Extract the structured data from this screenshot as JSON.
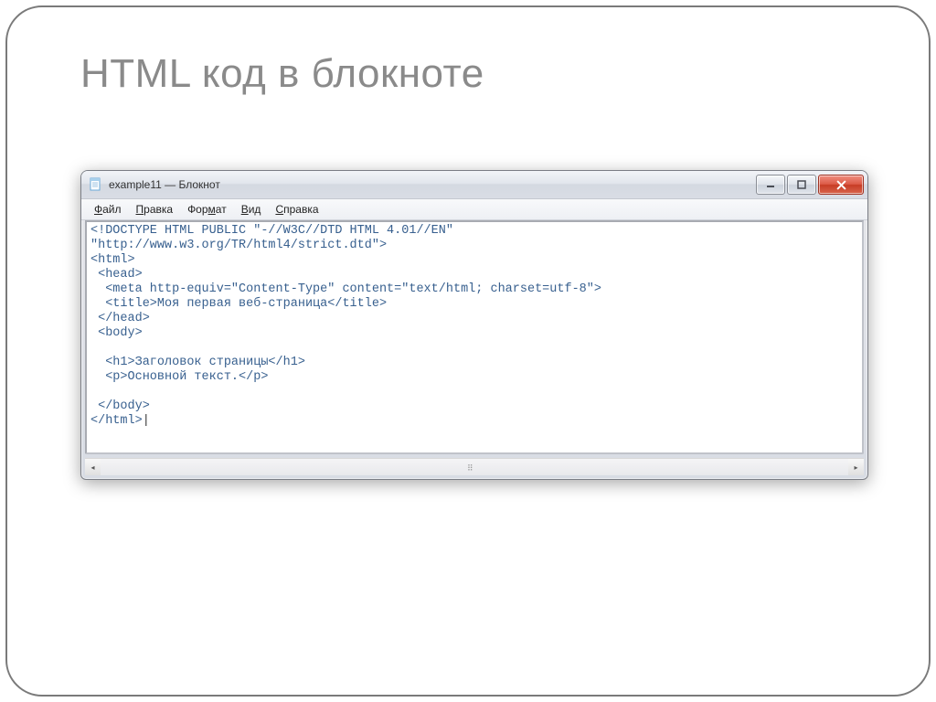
{
  "slide": {
    "title": "HTML код  в блокноте"
  },
  "window": {
    "title": "example11 — Блокнот",
    "menu": {
      "file": "Файл",
      "edit": "Правка",
      "format": "Формат",
      "view": "Вид",
      "help": "Справка"
    },
    "content": "<!DOCTYPE HTML PUBLIC \"-//W3C//DTD HTML 4.01//EN\"\n\"http://www.w3.org/TR/html4/strict.dtd\">\n<html>\n <head>\n  <meta http-equiv=\"Content-Type\" content=\"text/html; charset=utf-8\">\n  <title>Моя первая веб-страница</title>\n </head>\n <body>\n\n  <h1>Заголовок страницы</h1>\n  <p>Основной текст.</p>\n\n </body>\n</html>",
    "cursor": "|"
  }
}
